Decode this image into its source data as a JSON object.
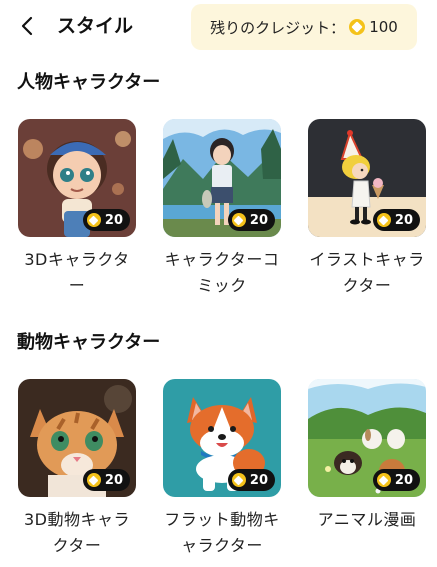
{
  "header": {
    "title": "スタイル",
    "credit_label": "残りのクレジット：",
    "credit_value": "100"
  },
  "sections": [
    {
      "title": "人物キャラクター",
      "items": [
        {
          "label": "3Dキャラクター",
          "cost": "20",
          "thumbnail_icon": "3d-girl-image"
        },
        {
          "label": "キャラクターコミック",
          "cost": "20",
          "thumbnail_icon": "anime-girl-lake-image"
        },
        {
          "label": "イラストキャラクター",
          "cost": "20",
          "thumbnail_icon": "illustrated-boy-icecream-image"
        }
      ]
    },
    {
      "title": "動物キャラクター",
      "items": [
        {
          "label": "3D動物キャラクター",
          "cost": "20",
          "thumbnail_icon": "3d-kitten-image"
        },
        {
          "label": "フラット動物キャラクター",
          "cost": "20",
          "thumbnail_icon": "flat-corgi-image"
        },
        {
          "label": "アニマル漫画",
          "cost": "20",
          "thumbnail_icon": "cartoon-puppies-meadow-image"
        }
      ]
    }
  ],
  "colors": {
    "credit_bg": "#fdf6dc",
    "coin": "#f4c21b",
    "badge_bg": "#111111"
  }
}
